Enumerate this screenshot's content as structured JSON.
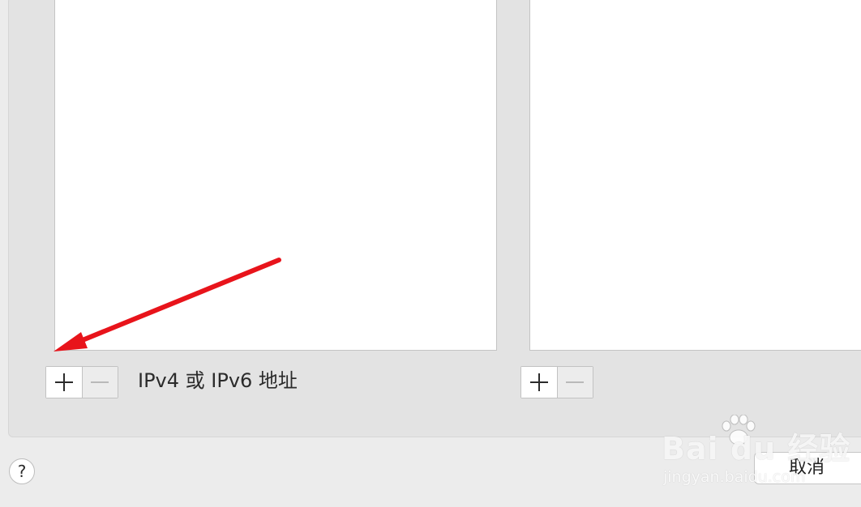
{
  "left_panel": {
    "hint_label": "IPv4 或 IPv6 地址",
    "add_symbol": "+",
    "remove_symbol": "−"
  },
  "right_panel": {
    "add_symbol": "+",
    "remove_symbol": "−"
  },
  "footer": {
    "help_label": "?",
    "cancel_label": "取消"
  },
  "watermark": {
    "brand_text": "Bai du 经验",
    "url_text": "jingyan.baidu.com"
  },
  "icons": {
    "add": "plus-icon",
    "remove": "minus-icon",
    "help": "question-mark-icon",
    "annotation": "red-arrow-icon",
    "watermark_logo": "paw-icon"
  },
  "colors": {
    "annotation_arrow": "#e8141b",
    "window_background": "#ececec",
    "group_background": "#e3e3e3",
    "list_background": "#ffffff"
  }
}
